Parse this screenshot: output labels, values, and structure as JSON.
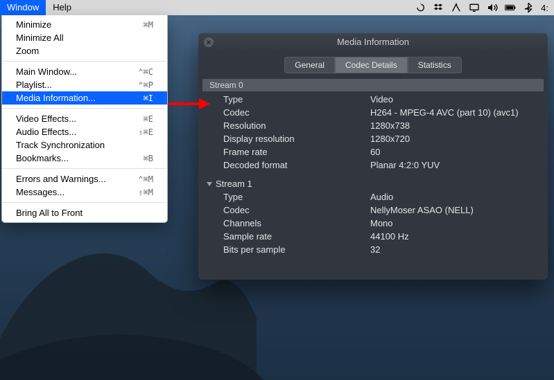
{
  "menubar": {
    "active": "Window",
    "labels": [
      "Window",
      "Help"
    ],
    "clock": "4:"
  },
  "menu": {
    "items": [
      {
        "label": "Minimize",
        "shortcut": "⌘M"
      },
      {
        "label": "Minimize All"
      },
      {
        "label": "Zoom"
      },
      {
        "sep": true
      },
      {
        "label": "Main Window...",
        "shortcut": "⌃⌘C"
      },
      {
        "label": "Playlist...",
        "shortcut": "⌃⌘P"
      },
      {
        "label": "Media Information...",
        "shortcut": "⌘I",
        "hl": true
      },
      {
        "sep": true
      },
      {
        "label": "Video Effects...",
        "shortcut": "⌘E"
      },
      {
        "label": "Audio Effects...",
        "shortcut": "⇧⌘E"
      },
      {
        "label": "Track Synchronization"
      },
      {
        "label": "Bookmarks...",
        "shortcut": "⌘B"
      },
      {
        "sep": true
      },
      {
        "label": "Errors and Warnings...",
        "shortcut": "⌃⌘M"
      },
      {
        "label": "Messages...",
        "shortcut": "⇧⌘M"
      },
      {
        "sep": true
      },
      {
        "label": "Bring All to Front"
      }
    ]
  },
  "win": {
    "title": "Media Information",
    "tabs": [
      "General",
      "Codec Details",
      "Statistics"
    ],
    "selected_tab": "Codec Details",
    "streams": [
      {
        "name": "Stream 0",
        "rows": [
          {
            "k": "Type",
            "v": "Video"
          },
          {
            "k": "Codec",
            "v": "H264 - MPEG-4 AVC (part 10) (avc1)"
          },
          {
            "k": "Resolution",
            "v": "1280x738"
          },
          {
            "k": "Display resolution",
            "v": "1280x720"
          },
          {
            "k": "Frame rate",
            "v": "60"
          },
          {
            "k": "Decoded format",
            "v": "Planar 4:2:0 YUV"
          }
        ]
      },
      {
        "name": "Stream 1",
        "rows": [
          {
            "k": "Type",
            "v": "Audio"
          },
          {
            "k": "Codec",
            "v": "NellyMoser ASAO (NELL)"
          },
          {
            "k": "Channels",
            "v": "Mono"
          },
          {
            "k": "Sample rate",
            "v": "44100 Hz"
          },
          {
            "k": "Bits per sample",
            "v": "32"
          }
        ]
      }
    ]
  }
}
